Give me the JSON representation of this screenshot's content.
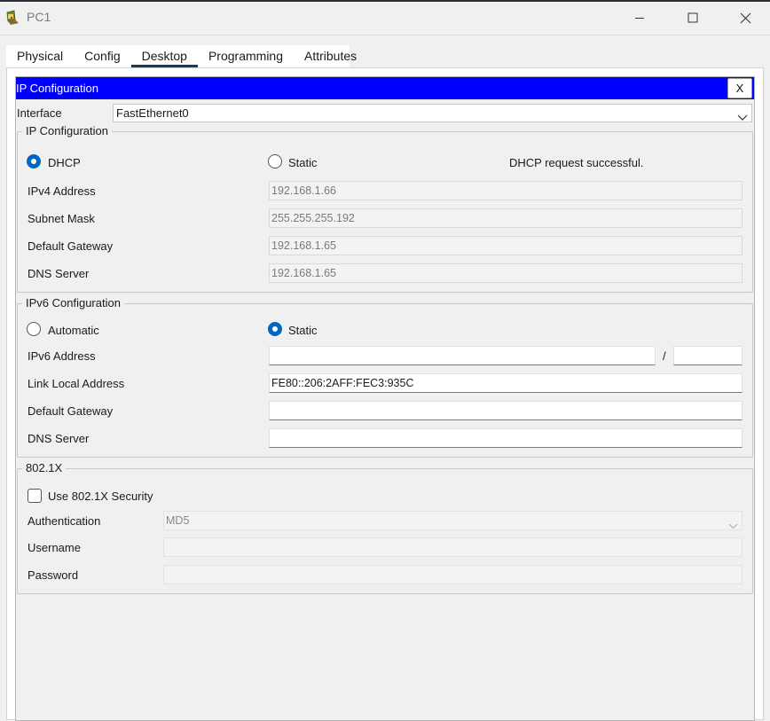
{
  "window": {
    "title": "PC1",
    "minimize_icon": "minimize-icon",
    "maximize_icon": "maximize-icon",
    "close_icon": "close-icon"
  },
  "tabs": [
    "Physical",
    "Config",
    "Desktop",
    "Programming",
    "Attributes"
  ],
  "active_tab": "Desktop",
  "header": {
    "title": "IP Configuration",
    "close_label": "X",
    "color": "#0000ff"
  },
  "interface": {
    "label": "Interface",
    "value": "FastEthernet0"
  },
  "ipv4": {
    "group_title": "IP Configuration",
    "dhcp_label": "DHCP",
    "static_label": "Static",
    "mode": "DHCP",
    "status": "DHCP request successful.",
    "fields": [
      {
        "label": "IPv4 Address",
        "value": "192.168.1.66"
      },
      {
        "label": "Subnet Mask",
        "value": "255.255.255.192"
      },
      {
        "label": "Default Gateway",
        "value": "192.168.1.65"
      },
      {
        "label": "DNS Server",
        "value": "192.168.1.65"
      }
    ]
  },
  "ipv6": {
    "group_title": "IPv6 Configuration",
    "automatic_label": "Automatic",
    "static_label": "Static",
    "mode": "Static",
    "address_label": "IPv6 Address",
    "address_value": "",
    "prefix_separator": "/",
    "prefix_value": "",
    "link_local_label": "Link Local Address",
    "link_local_value": "FE80::206:2AFF:FEC3:935C",
    "gateway_label": "Default Gateway",
    "gateway_value": "",
    "dns_label": "DNS Server",
    "dns_value": ""
  },
  "dot1x": {
    "group_title": "802.1X",
    "checkbox_label": "Use 802.1X Security",
    "checked": false,
    "auth_label": "Authentication",
    "auth_value": "MD5",
    "username_label": "Username",
    "username_value": "",
    "password_label": "Password",
    "password_value": ""
  }
}
